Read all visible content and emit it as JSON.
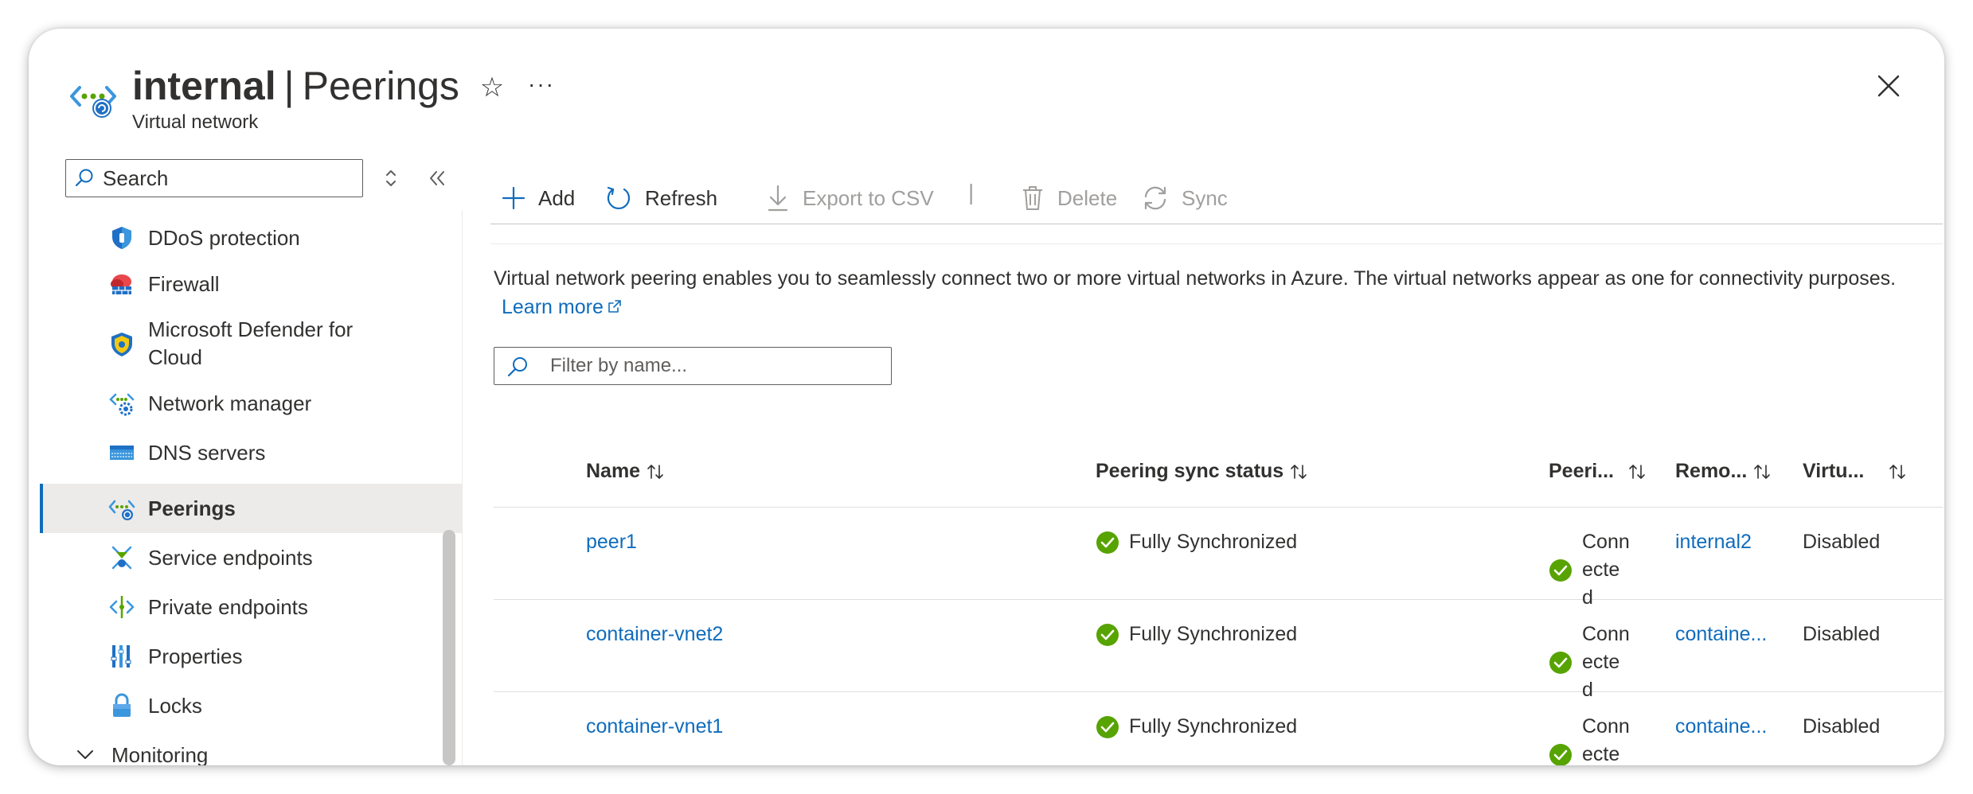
{
  "header": {
    "resource_name": "internal",
    "separator": "|",
    "page_name": "Peerings",
    "subtitle": "Virtual network",
    "favorite_icon": "star-icon",
    "more_label": "···",
    "close_icon": "close-icon"
  },
  "search": {
    "placeholder": "Search",
    "value": ""
  },
  "sidebar": {
    "items": [
      {
        "label": "DDoS protection",
        "icon": "ddos-shield-icon",
        "active": false
      },
      {
        "label": "Firewall",
        "icon": "firewall-icon",
        "active": false
      },
      {
        "label": "Microsoft Defender for Cloud",
        "icon": "defender-icon",
        "active": false
      },
      {
        "label": "Network manager",
        "icon": "network-manager-icon",
        "active": false
      },
      {
        "label": "DNS servers",
        "icon": "dns-servers-icon",
        "active": false
      },
      {
        "label": "Peerings",
        "icon": "peerings-icon",
        "active": true
      },
      {
        "label": "Service endpoints",
        "icon": "service-endpoints-icon",
        "active": false
      },
      {
        "label": "Private endpoints",
        "icon": "private-endpoints-icon",
        "active": false
      },
      {
        "label": "Properties",
        "icon": "properties-icon",
        "active": false
      },
      {
        "label": "Locks",
        "icon": "lock-icon",
        "active": false
      }
    ],
    "group": {
      "label": "Monitoring",
      "icon": "chevron-down-icon"
    }
  },
  "toolbar": {
    "add": "Add",
    "refresh": "Refresh",
    "export": "Export to CSV",
    "separator": "|",
    "delete": "Delete",
    "sync": "Sync"
  },
  "description": {
    "text": "Virtual network peering enables you to seamlessly connect two or more virtual networks in Azure. The virtual networks appear as one for connectivity purposes.",
    "link": "Learn more"
  },
  "filter": {
    "placeholder": "Filter by name...",
    "value": ""
  },
  "table": {
    "columns": [
      "Name",
      "Peering sync status",
      "Peeri...",
      "Remo...",
      "Virtu..."
    ],
    "rows": [
      {
        "name": "peer1",
        "sync_status": "Fully Synchronized",
        "peering_status": "Connected",
        "remote": "internal2",
        "virtual": "Disabled"
      },
      {
        "name": "container-vnet2",
        "sync_status": "Fully Synchronized",
        "peering_status": "Connected",
        "remote": "containe...",
        "virtual": "Disabled"
      },
      {
        "name": "container-vnet1",
        "sync_status": "Fully Synchronized",
        "peering_status": "Connected",
        "remote": "containe...",
        "virtual": "Disabled"
      }
    ]
  },
  "colors": {
    "link": "#0f6cbd",
    "success": "#57a300",
    "active_bg": "#edebe9",
    "text": "#323130"
  }
}
